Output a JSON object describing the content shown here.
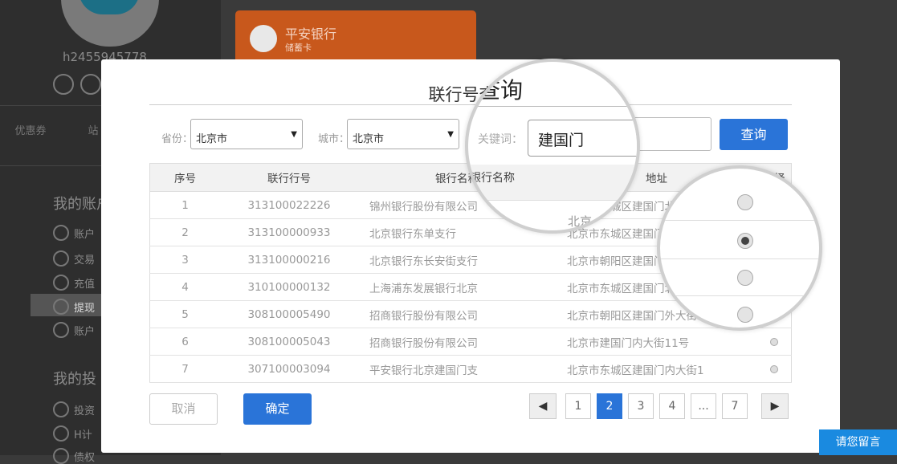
{
  "background": {
    "username": "h2455945778",
    "promo_items": [
      "优惠券",
      "站"
    ],
    "section_account": "我的账户",
    "nav": [
      {
        "label": "账户"
      },
      {
        "label": "交易"
      },
      {
        "label": "充值"
      },
      {
        "label": "提现"
      },
      {
        "label": "账户"
      }
    ],
    "section_invest": "我的投",
    "nav2": [
      {
        "label": "投资"
      },
      {
        "label": "H计"
      },
      {
        "label": "债权"
      }
    ],
    "card": {
      "bank_name": "平安银行",
      "card_type": "储蓄卡"
    }
  },
  "modal": {
    "title": "联行号查询",
    "province_label": "省份：",
    "province_value": "北京市",
    "city_label": "城市：",
    "city_value": "北京市",
    "keyword_label": "关键词：",
    "keyword_value": "建国门",
    "query_button": "查询",
    "table": {
      "headers": [
        "序号",
        "联行行号",
        "银行名称",
        "地址",
        "选择"
      ],
      "rows": [
        {
          "no": "1",
          "code": "313100022226",
          "name": "锦州银行股份有限公司",
          "addr": "北京市东城区建国门北大街",
          "selected": false
        },
        {
          "no": "2",
          "code": "313100000933",
          "name": "北京银行东单支行",
          "addr": "北京市东城区建国门内大街",
          "selected": true
        },
        {
          "no": "3",
          "code": "313100000216",
          "name": "北京银行东长安街支行",
          "addr": "北京市朝阳区建国门外大街",
          "selected": false
        },
        {
          "no": "4",
          "code": "310100000132",
          "name": "上海浦东发展银行北京",
          "addr": "北京市东城区建国门北大街",
          "selected": false
        },
        {
          "no": "5",
          "code": "308100005490",
          "name": "招商银行股份有限公司",
          "addr": "北京市朝阳区建国门外大街2",
          "selected": false
        },
        {
          "no": "6",
          "code": "308100005043",
          "name": "招商银行股份有限公司",
          "addr": "北京市建国门内大街11号",
          "selected": false
        },
        {
          "no": "7",
          "code": "307100003094",
          "name": "平安银行北京建国门支",
          "addr": "北京市东城区建国门内大街1",
          "selected": false
        }
      ]
    },
    "cancel_button": "取消",
    "ok_button": "确定",
    "pagination": {
      "prev": "◀",
      "pages": [
        "1",
        "2",
        "3",
        "4",
        "...",
        "7"
      ],
      "current": "2",
      "next": "▶"
    },
    "magnifier": {
      "head_fragment": "银行名称",
      "addr_fragment": "北京"
    }
  },
  "message_button": "请您留言",
  "colors": {
    "accent": "#2a74d8",
    "card": "#c8581c",
    "message": "#1a8ae0"
  }
}
